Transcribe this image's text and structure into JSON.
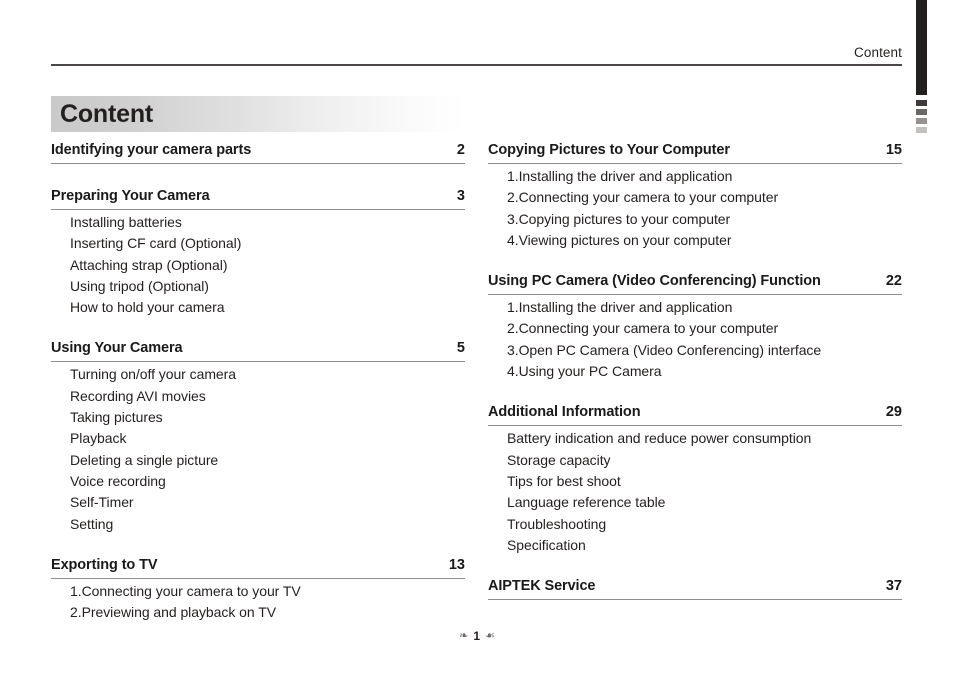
{
  "header": {
    "running_head": "Content"
  },
  "title": {
    "text": "Content"
  },
  "footer": {
    "ornament_left": "❧",
    "page_number": "1",
    "ornament_right": "☙"
  },
  "left_column": {
    "sections": [
      {
        "title": "Identifying your camera parts",
        "page": "2",
        "items": []
      },
      {
        "title": "Preparing Your Camera",
        "page": "3",
        "items": [
          "Installing batteries",
          "Inserting CF card (Optional)",
          "Attaching strap (Optional)",
          "Using tripod (Optional)",
          "How to hold your camera"
        ]
      },
      {
        "title": "Using Your Camera",
        "page": "5",
        "items": [
          "Turning on/off your camera",
          "Recording AVI movies",
          "Taking pictures",
          "Playback",
          "Deleting a single picture",
          "Voice recording",
          "Self-Timer",
          "Setting"
        ]
      },
      {
        "title": "Exporting to TV",
        "page": "13",
        "items": [
          "1.Connecting your camera to your TV",
          "2.Previewing and playback on TV"
        ]
      }
    ]
  },
  "right_column": {
    "sections": [
      {
        "title": "Copying Pictures to Your Computer",
        "page": "15",
        "items": [
          "1.Installing the driver and application",
          "2.Connecting your camera to your computer",
          "3.Copying pictures to your computer",
          "4.Viewing pictures on your computer"
        ]
      },
      {
        "title": "Using PC Camera (Video Conferencing) Function",
        "page": "22",
        "items": [
          "1.Installing the driver and application",
          "2.Connecting your camera to your computer",
          "3.Open PC Camera (Video Conferencing) interface",
          "4.Using your PC Camera"
        ]
      },
      {
        "title": "Additional Information",
        "page": "29",
        "items": [
          "Battery indication and reduce power consumption",
          "Storage capacity",
          "Tips for best shoot",
          "Language reference table",
          "Troubleshooting",
          "Specification"
        ]
      },
      {
        "title": "AIPTEK Service",
        "page": "37",
        "items": []
      }
    ]
  },
  "edge_marker": {
    "square_colors": [
      "#3d3a39",
      "#6a6766",
      "#949190",
      "#c3c1c0"
    ],
    "bar_color": "#231f1e"
  }
}
